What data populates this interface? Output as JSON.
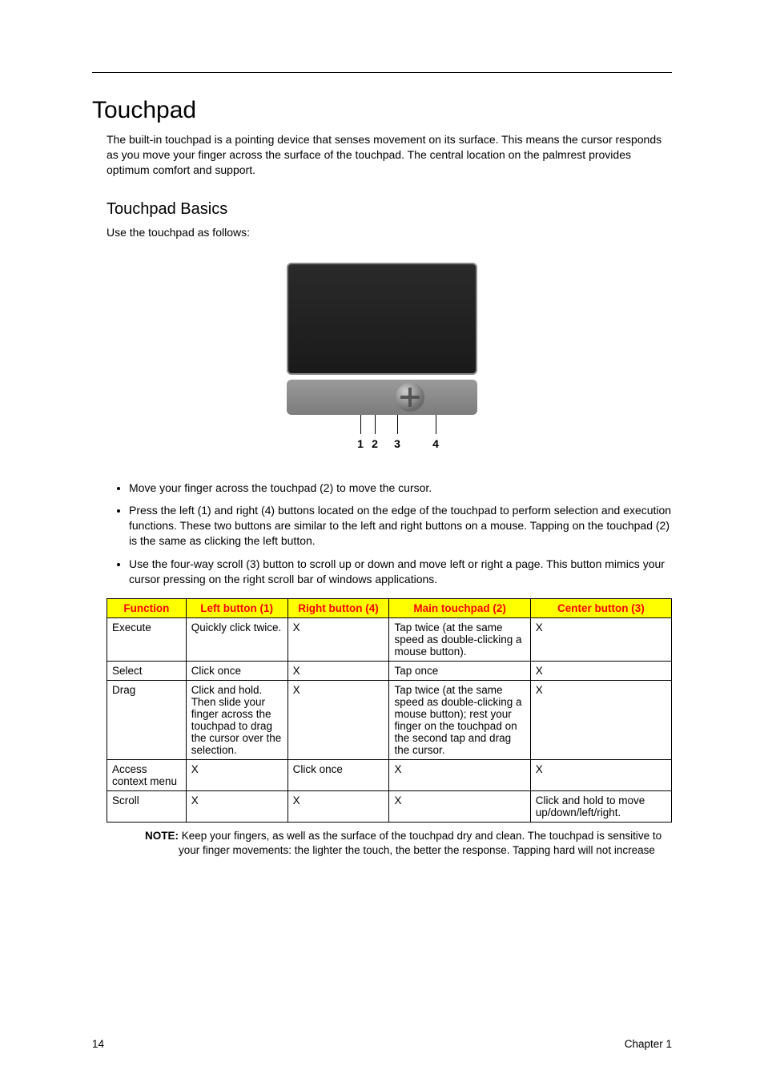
{
  "section": {
    "title": "Touchpad",
    "intro": "The built-in touchpad is a pointing device that senses movement on its surface. This means the cursor responds as you move your finger across the surface of the touchpad. The central location on the palmrest provides optimum comfort and support."
  },
  "subsection": {
    "title": "Touchpad Basics",
    "lead": "Use the touchpad as follows:"
  },
  "figure_labels": {
    "n1": "1",
    "n2": "2",
    "n3": "3",
    "n4": "4"
  },
  "bullets": [
    "Move your finger across the touchpad (2) to move the cursor.",
    "Press the left (1) and right (4) buttons located on the edge of the touchpad to perform selection and execution functions. These two buttons are similar to the left and right buttons on a mouse. Tapping on the touchpad (2) is the same as clicking the left button.",
    "Use the four-way scroll (3) button to scroll up or down and move left or right a page. This button mimics your cursor pressing on the right scroll bar of windows applications."
  ],
  "table": {
    "headers": {
      "function": "Function",
      "left": "Left button (1)",
      "right": "Right button (4)",
      "main": "Main touchpad (2)",
      "center": "Center button (3)"
    },
    "rows": [
      {
        "function": "Execute",
        "left": "Quickly click twice.",
        "right": "X",
        "main": "Tap twice (at the same speed as double-clicking a mouse button).",
        "center": "X"
      },
      {
        "function": "Select",
        "left": "Click once",
        "right": "X",
        "main": "Tap once",
        "center": "X"
      },
      {
        "function": "Drag",
        "left": "Click and hold. Then slide your finger across the touchpad to drag the cursor over the selection.",
        "right": "X",
        "main": "Tap twice (at the same speed as double-clicking a mouse button); rest your finger on the touchpad on the second tap and drag the cursor.",
        "center": "X"
      },
      {
        "function": "Access context menu",
        "left": "X",
        "right": "Click once",
        "main": "X",
        "center": "X"
      },
      {
        "function": "Scroll",
        "left": "X",
        "right": "X",
        "main": "X",
        "center": "Click and hold to move up/down/left/right."
      }
    ]
  },
  "note": {
    "label": "NOTE:",
    "text": "Keep your fingers, as well as the surface of the touchpad dry and clean. The touchpad is sensitive to your finger movements: the lighter the touch, the better the response. Tapping hard will not increase"
  },
  "footer": {
    "page": "14",
    "chapter": "Chapter 1"
  }
}
